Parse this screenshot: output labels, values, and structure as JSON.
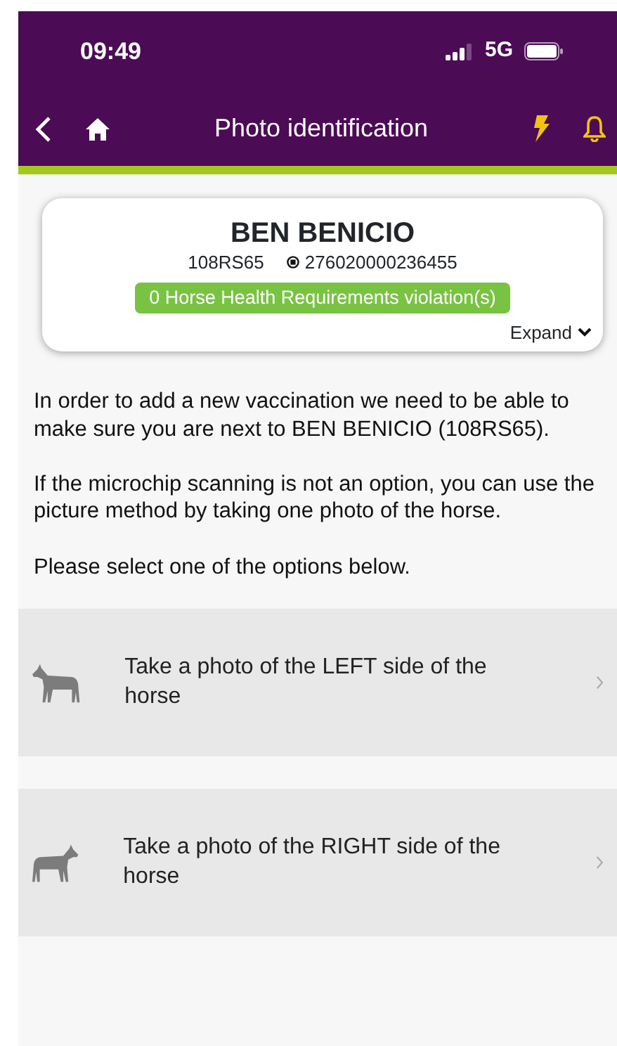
{
  "status_bar": {
    "time": "09:49",
    "network": "5G"
  },
  "header": {
    "title": "Photo identification"
  },
  "horse_card": {
    "name": "BEN BENICIO",
    "registration": "108RS65",
    "microchip": "276020000236455",
    "violations": "0 Horse Health Requirements violation(s)",
    "expand": "Expand"
  },
  "paragraphs": [
    "In order to add a new vaccination we need to be able to make sure you are next to BEN BENICIO (108RS65).",
    "If the microchip scanning is not an option, you can use the picture method by taking one photo of the horse.",
    "Please select one of the options below."
  ],
  "options": [
    {
      "kind": "left",
      "label": "Take a photo of the LEFT side of the horse"
    },
    {
      "kind": "right",
      "label": "Take a photo of the RIGHT side of the horse"
    }
  ]
}
